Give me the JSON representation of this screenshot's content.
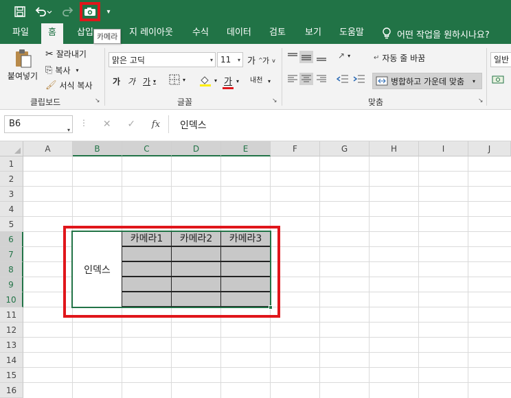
{
  "tooltip": "카메라",
  "tabs": [
    {
      "label": "파일",
      "active": false
    },
    {
      "label": "홈",
      "active": true
    },
    {
      "label": "삽입",
      "active": false
    },
    {
      "label": "지 레이아웃",
      "active": false
    },
    {
      "label": "수식",
      "active": false
    },
    {
      "label": "데이터",
      "active": false
    },
    {
      "label": "검토",
      "active": false
    },
    {
      "label": "보기",
      "active": false
    },
    {
      "label": "도움말",
      "active": false
    }
  ],
  "tell_me": "어떤 작업을 원하시나요?",
  "ribbon": {
    "clipboard": {
      "paste": "붙여넣기",
      "cut": "잘라내기",
      "copy": "복사",
      "format_painter": "서식 복사",
      "label": "클립보드"
    },
    "font": {
      "name": "맑은 고딕",
      "size": "11",
      "grow": "가",
      "shrink": "가",
      "bold": "가",
      "italic": "가",
      "underline": "가",
      "font_color": "가",
      "phonetic": "내천",
      "label": "글꼴"
    },
    "alignment": {
      "wrap_text": "자동 줄 바꿈",
      "merge_center": "병합하고 가운데 맞춤",
      "label": "맞춤"
    },
    "number": {
      "format": "일반"
    }
  },
  "formula_bar": {
    "name_box": "B6",
    "fx": "fx",
    "value": "인덱스"
  },
  "columns": [
    "A",
    "B",
    "C",
    "D",
    "E",
    "F",
    "G",
    "H",
    "I",
    "J"
  ],
  "rows": [
    "1",
    "2",
    "3",
    "4",
    "5",
    "6",
    "7",
    "8",
    "9",
    "10",
    "11",
    "12",
    "13",
    "14",
    "15",
    "16"
  ],
  "table": {
    "index_label": "인덱스",
    "headers": [
      "카메라1",
      "카메라2",
      "카메라3"
    ]
  },
  "colors": {
    "excel_green": "#217346",
    "highlight_red": "#e0161b",
    "cell_gray": "#c8c8c8"
  }
}
